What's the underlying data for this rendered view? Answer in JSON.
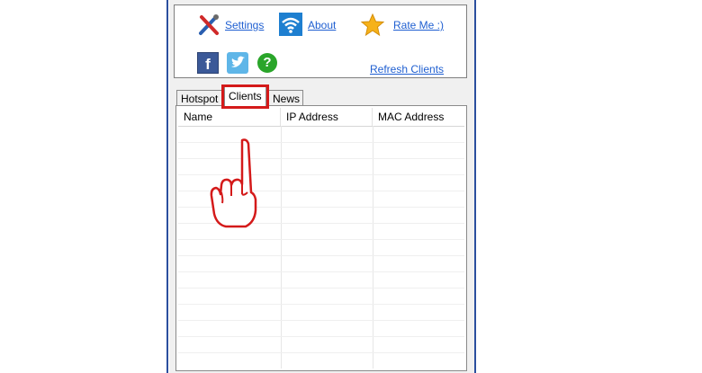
{
  "toolbar": {
    "settings_label": "Settings",
    "about_label": "About",
    "rate_label": "Rate Me :)",
    "refresh_label": "Refresh Clients",
    "facebook_glyph": "f",
    "help_glyph": "?"
  },
  "tabs": [
    {
      "label": "Hotspot"
    },
    {
      "label": "Clients"
    },
    {
      "label": "News"
    }
  ],
  "clients_table": {
    "columns": [
      "Name",
      "IP Address",
      "MAC Address"
    ],
    "rows": []
  },
  "colors": {
    "link": "#1f5fd1",
    "highlight": "#d41a1a",
    "window_border": "#2b4f9e"
  },
  "icons": [
    "settings-tools-icon",
    "wifi-icon",
    "star-icon",
    "facebook-icon",
    "twitter-icon",
    "help-icon",
    "pointing-hand-icon"
  ]
}
